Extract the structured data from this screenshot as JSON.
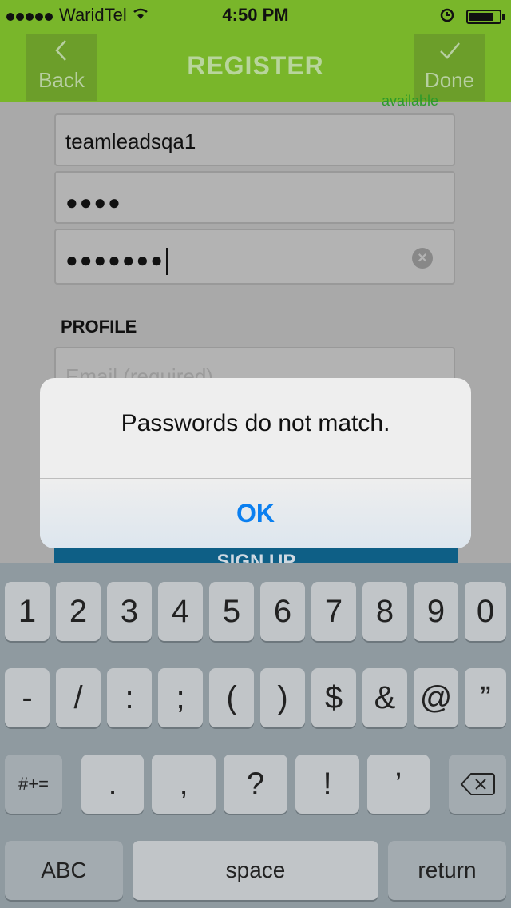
{
  "status_bar": {
    "carrier": "WaridTel",
    "time": "4:50 PM",
    "signal_dots": 5
  },
  "nav": {
    "back_icon": "chevron-left-icon",
    "back_label": "Back",
    "title": "REGISTER",
    "done_icon": "checkmark-icon",
    "done_label": "Done",
    "available_text": "available"
  },
  "form": {
    "username_value": "teamleadsqa1",
    "password_value": "●●●●",
    "confirm_value": "●●●●●●●",
    "section_title": "PROFILE",
    "email_placeholder": "Email (required)",
    "signup_label": "SIGN UP"
  },
  "alert": {
    "message": "Passwords do not match.",
    "ok_label": "OK"
  },
  "keyboard": {
    "row1": [
      "1",
      "2",
      "3",
      "4",
      "5",
      "6",
      "7",
      "8",
      "9",
      "0"
    ],
    "row2": [
      "-",
      "/",
      ":",
      ";",
      "(",
      ")",
      "$",
      "&",
      "@",
      "”"
    ],
    "row3_left": "#+=",
    "row3": [
      ".",
      ",",
      "?",
      "!",
      "’"
    ],
    "row4_abc": "ABC",
    "row4_space": "space",
    "row4_return": "return"
  },
  "colors": {
    "nav_green": "#79b62a",
    "alert_button_blue": "#0a7ff0",
    "signup_blue": "#0e5f86"
  }
}
